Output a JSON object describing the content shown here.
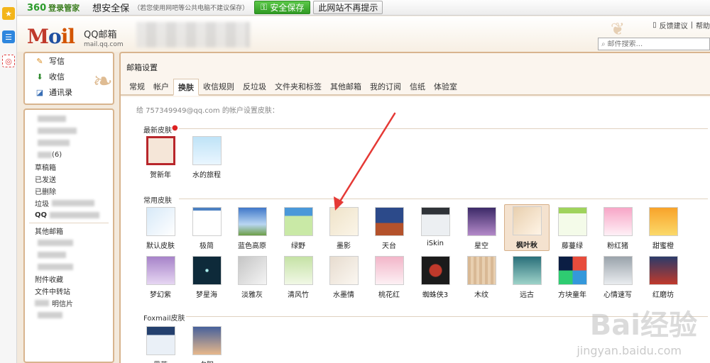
{
  "notice_bar": {
    "brand": "360",
    "brand_sub": "登录管家",
    "message": "想安全保",
    "message_tail": "（若您使用网吧等公共电脑不建议保存）",
    "save_button": "安全保存",
    "noshow_button": "此网站不再提示"
  },
  "header": {
    "logo_m": "M",
    "logo_o": "o",
    "logo_il": "il",
    "product": "QQ邮箱",
    "domain": "mail.qq.com",
    "links": [
      "反馈建议",
      "帮助"
    ],
    "search_placeholder": "邮件搜索..."
  },
  "nav": {
    "compose": "写信",
    "inbox": "收信",
    "contacts": "通讯录",
    "folders": [
      "",
      "",
      "",
      "(6)",
      "草稿箱",
      "已发送",
      "已删除",
      "垃圾",
      "QQ",
      "",
      "其他邮箱",
      "",
      "",
      "",
      "附件收藏",
      "文件中转站",
      "明信片",
      ""
    ]
  },
  "main": {
    "title": "邮箱设置",
    "tabs": [
      "常规",
      "帐户",
      "换肤",
      "收信规则",
      "反垃圾",
      "文件夹和标签",
      "其他邮箱",
      "我的订阅",
      "信纸",
      "体验室"
    ],
    "active_tab": "换肤",
    "hint": "给 757349949@qq.com 的帐户设置皮肤：",
    "section_new": "最新皮肤",
    "section_common": "常用皮肤",
    "section_foxmail": "Foxmail皮肤",
    "new_skins": [
      "贺新年",
      "水的旅程"
    ],
    "common_row1": [
      "默认皮肤",
      "极简",
      "蓝色高原",
      "绿野",
      "墨影",
      "天台",
      "iSkin",
      "星空",
      "枫叶秋",
      "藤蔓绿",
      "粉红猪",
      "甜蜜橙"
    ],
    "common_row2": [
      "梦幻紫",
      "梦星海",
      "淡雅灰",
      "清风竹",
      "水墨情",
      "桃花红",
      "蜘蛛侠3",
      "木纹",
      "远古",
      "方块童年",
      "心情速写",
      "红磨坊"
    ],
    "foxmail_skins": [
      "墨蓝",
      "夕阳"
    ],
    "selected_skin": "枫叶秋"
  },
  "watermark": {
    "brand": "Bai经验",
    "url": "jingyan.baidu.com"
  },
  "colors": {
    "accent": "#d8b48e",
    "arrow": "#e53935",
    "save_green": "#2f9a22"
  }
}
